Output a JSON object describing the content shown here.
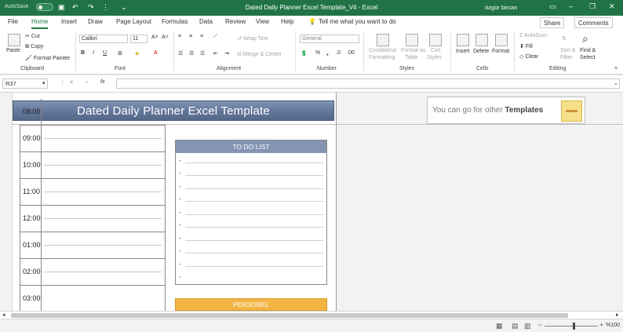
{
  "titlebar": {
    "autosave": "AutoSave",
    "autosave_state": "Off",
    "title": "Dated Daily Planner Excel Template_V4  -  Excel",
    "user": "özgür bircan"
  },
  "tabs": [
    "File",
    "Home",
    "Insert",
    "Draw",
    "Page Layout",
    "Formulas",
    "Data",
    "Review",
    "View",
    "Help"
  ],
  "active_tab": "Home",
  "tell_me": "Tell me what you want to do",
  "share_label": "Share",
  "comments_label": "Comments",
  "ribbon": {
    "clipboard": {
      "paste": "Paste",
      "cut": "Cut",
      "copy": "Copy",
      "format_painter": "Format Painter",
      "label": "Clipboard"
    },
    "font": {
      "name": "Calibri",
      "size": "11",
      "label": "Font"
    },
    "alignment": {
      "wrap": "Wrap Text",
      "merge": "Merge & Center",
      "label": "Alignment"
    },
    "number": {
      "format": "General",
      "label": "Number"
    },
    "styles": {
      "conditional": "Conditional",
      "formatting": "Formatting",
      "format_as": "Format as",
      "table": "Table",
      "cell": "Cell",
      "styles": "Styles",
      "label": "Styles"
    },
    "cells": {
      "insert": "Insert",
      "delete": "Delete",
      "format": "Format",
      "label": "Cells"
    },
    "editing": {
      "autosum": "AutoSum",
      "fill": "Fill",
      "clear": "Clear",
      "sort": "Sort &",
      "filter": "Filter",
      "find": "Find &",
      "select": "Select",
      "label": "Editing"
    }
  },
  "formula_bar": {
    "name_box": "R37",
    "fx": "fx",
    "value": ""
  },
  "sheet": {
    "banner_title": "Dated Daily Planner Excel Template",
    "promo_text": "You can go for other",
    "promo_bold": "Templates",
    "time_slots": [
      "08:00",
      "09:00",
      "10:00",
      "11:00",
      "12:00",
      "01:00",
      "02:00",
      "03:00"
    ],
    "todo_title": "TO DO LIST",
    "todo_items": [
      "-",
      "-",
      "-",
      "-",
      "-",
      "-",
      "-",
      "-",
      "-",
      "-"
    ],
    "personel_title": "PERSONEL"
  },
  "status": {
    "zoom": "%100"
  }
}
